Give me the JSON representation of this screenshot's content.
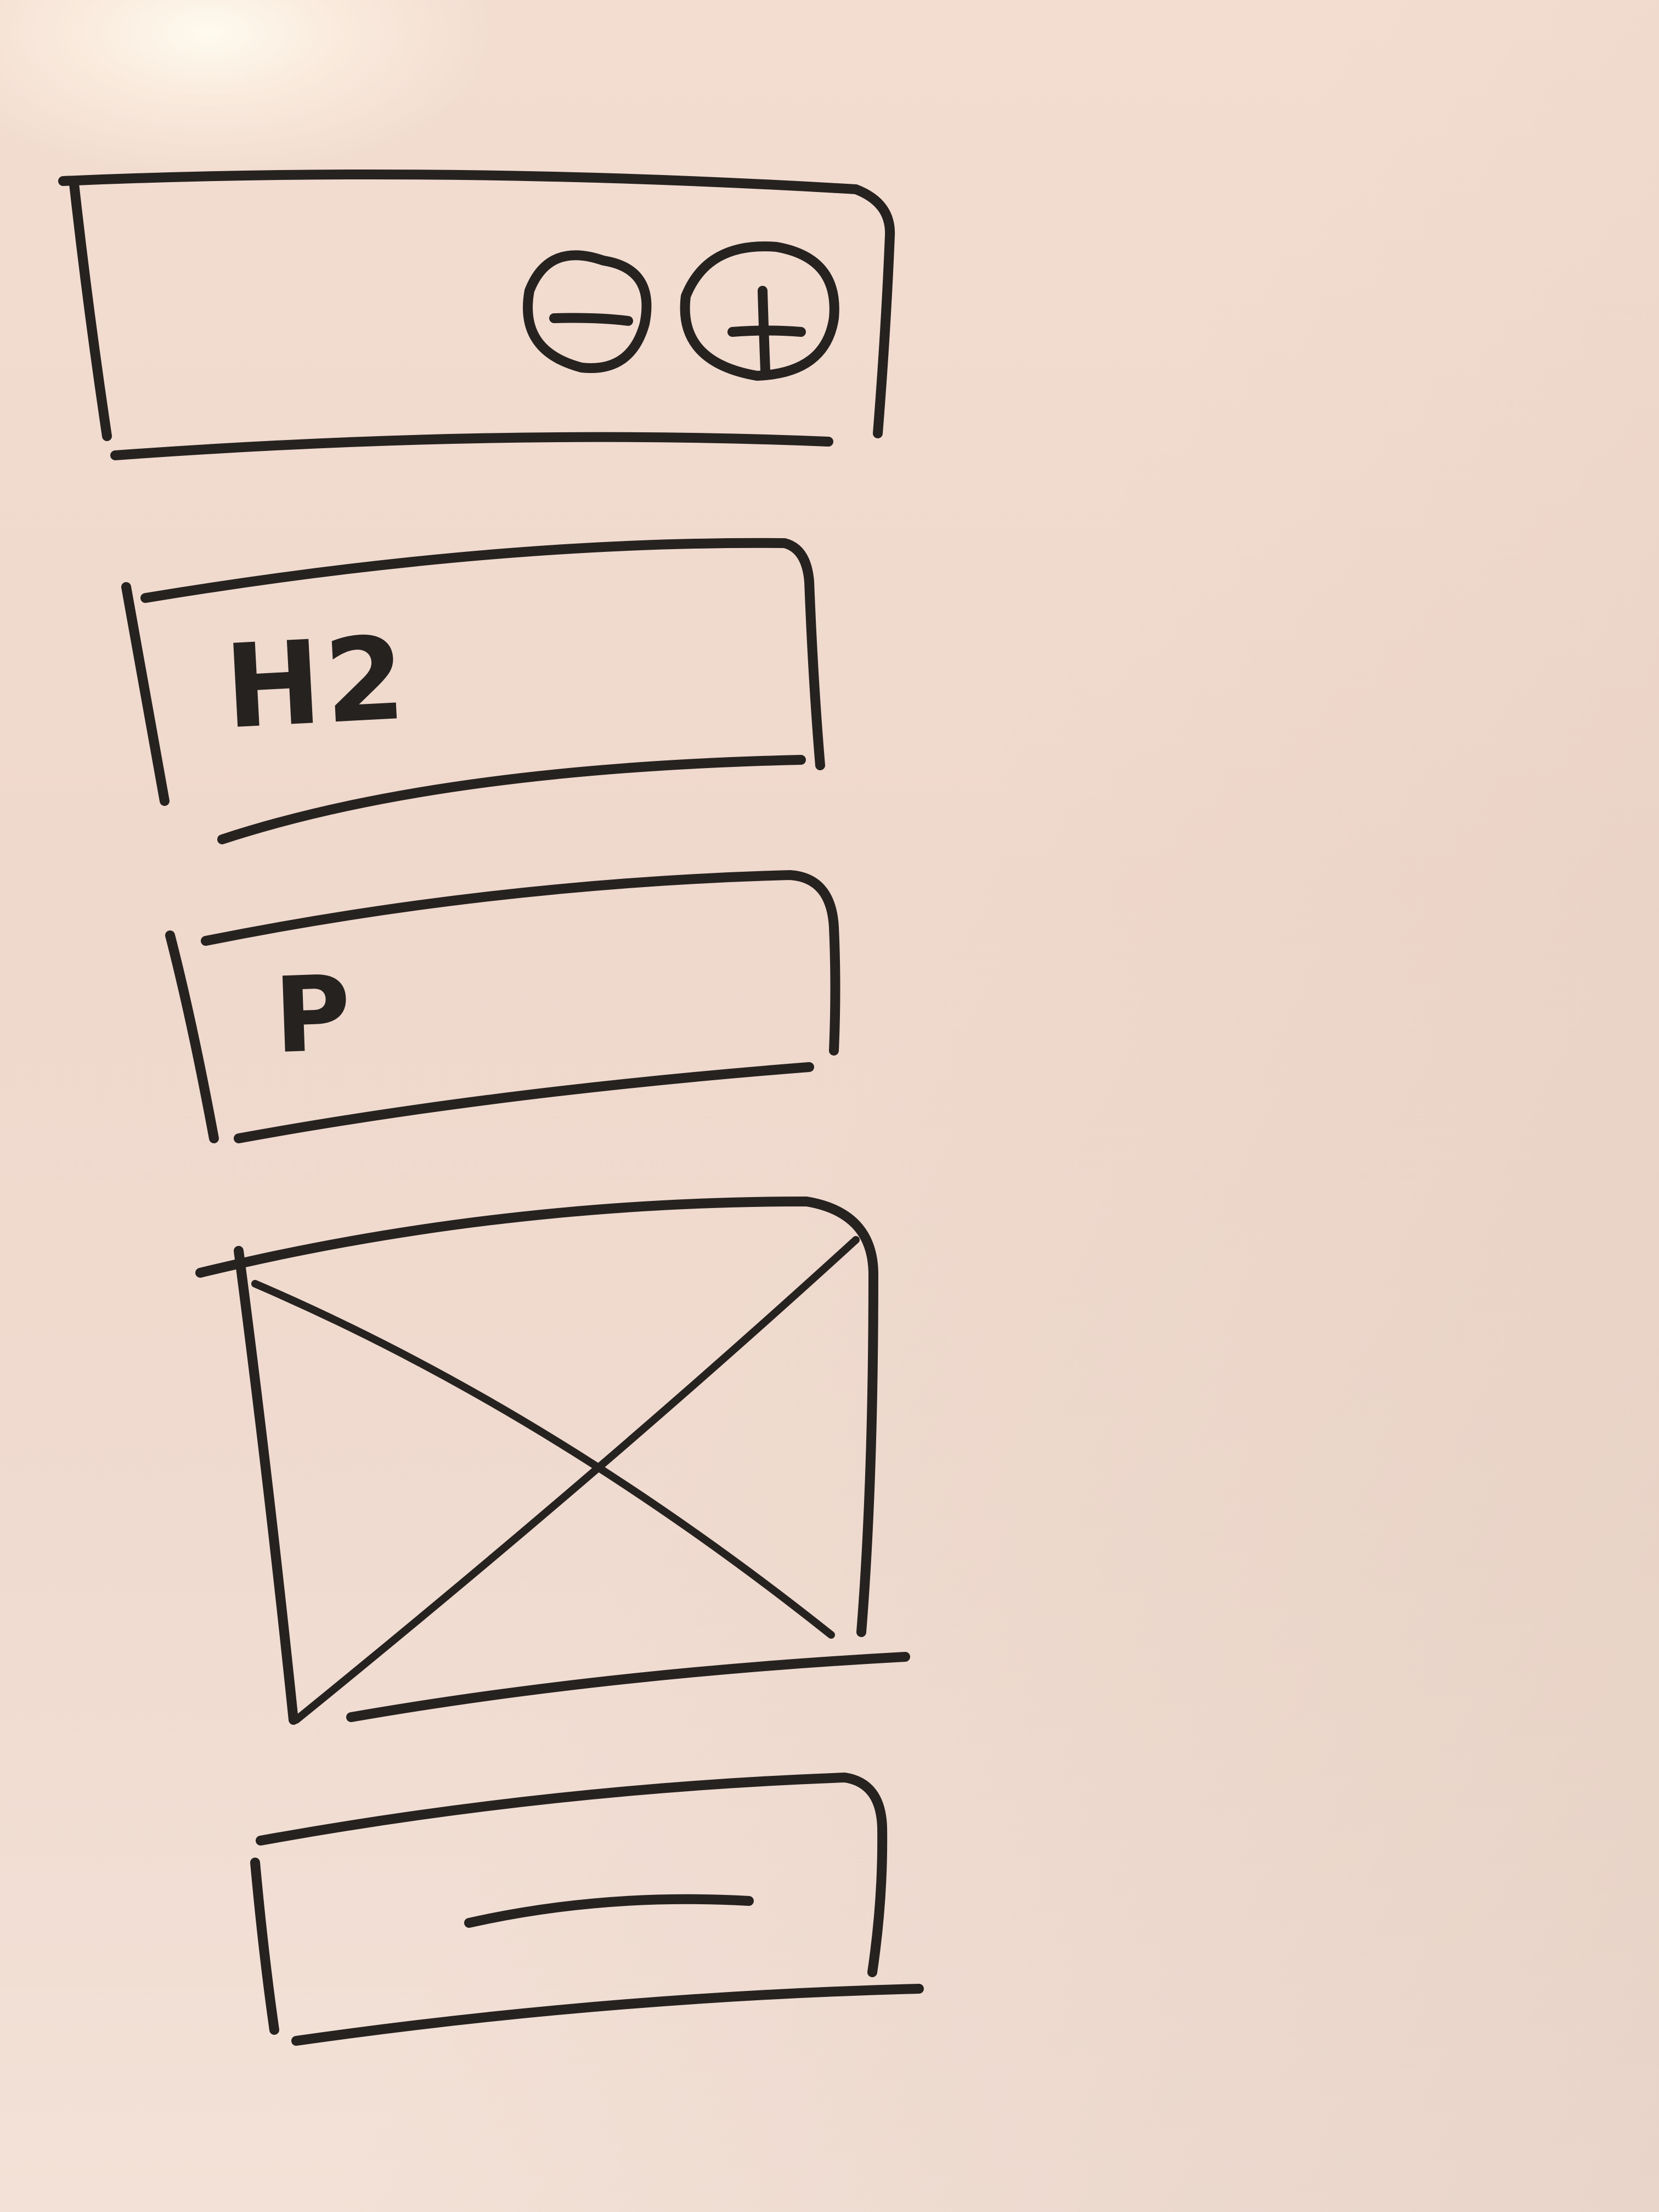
{
  "sketch": {
    "header": {
      "zoom_out_symbol": "−",
      "zoom_in_symbol": "+"
    },
    "heading_block": {
      "label": "H2"
    },
    "paragraph_block": {
      "label": "P"
    },
    "image_block": {
      "icon": "image-placeholder-x-icon"
    },
    "button_block": {
      "icon": "button-line-icon"
    },
    "colors": {
      "ink": "#262220",
      "board": "#f1d9cd"
    }
  }
}
